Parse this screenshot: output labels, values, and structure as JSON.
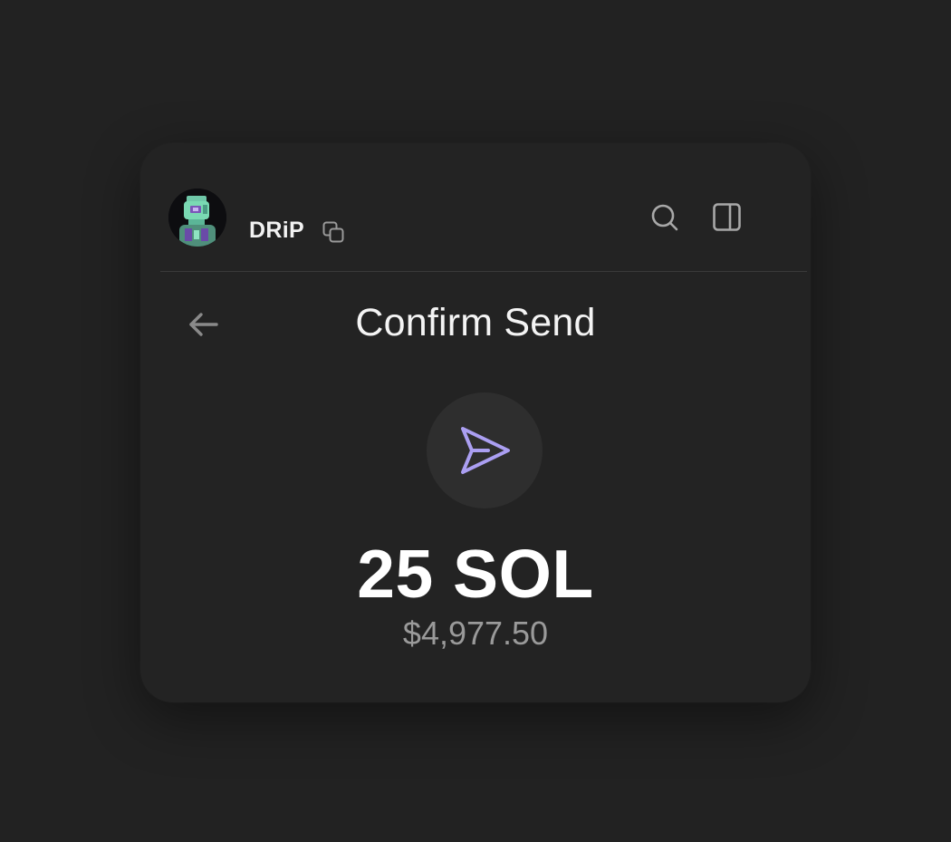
{
  "header": {
    "wallet_name": "DRiP",
    "icons": {
      "copy": "copy-icon",
      "search": "search-icon",
      "sidebar": "sidebar-panel-icon"
    }
  },
  "page": {
    "title": "Confirm Send",
    "back_icon": "arrow-left-icon",
    "send_icon": "paper-plane-icon"
  },
  "transaction": {
    "amount": "25 SOL",
    "fiat_value": "$4,977.50"
  },
  "colors": {
    "background": "#222222",
    "card": "#232323",
    "accent": "#ab9ff2",
    "muted_text": "#9a9a9a"
  }
}
